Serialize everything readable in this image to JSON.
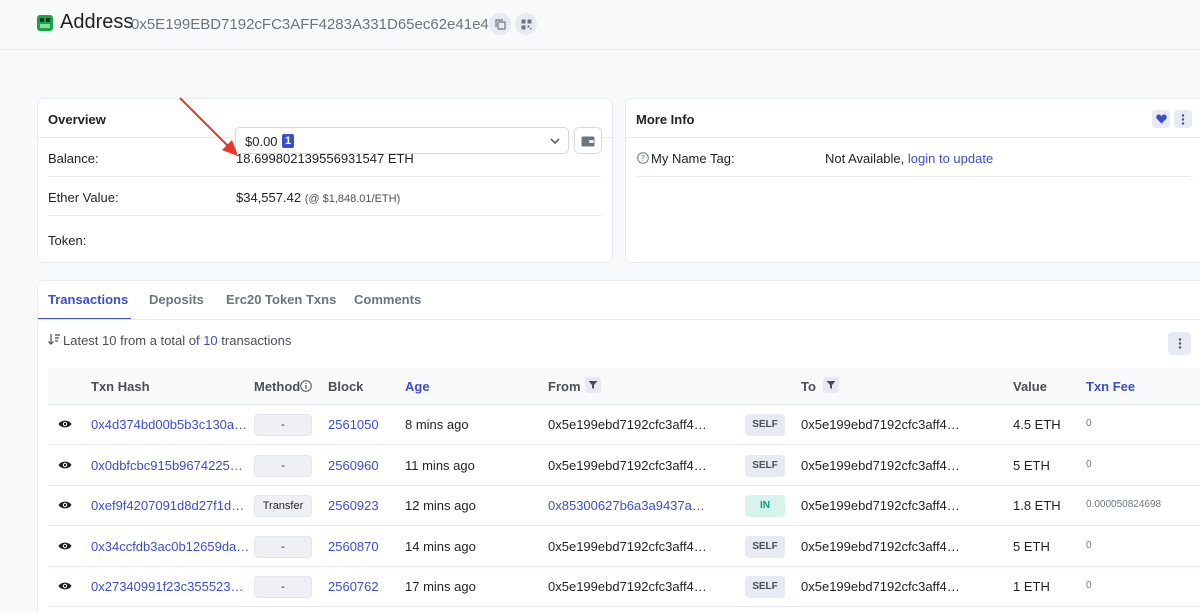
{
  "header": {
    "title": "Address",
    "address": "0x5E199EBD7192cFC3AFF4283A331D65ec62e41e46",
    "icons": [
      "logo-icon",
      "copy-icon",
      "qr-code-icon"
    ]
  },
  "overview": {
    "title": "Overview",
    "balance_label": "Balance:",
    "balance_value": "18.699802139556931547 ETH",
    "ether_value_label": "Ether Value:",
    "ether_value": "$34,557.42",
    "ether_price": "(@ $1,848.01/ETH)",
    "token_label": "Token:",
    "token_value": "$0.00",
    "token_count": "1"
  },
  "more_info": {
    "title": "More Info",
    "name_tag_label": "My Name Tag:",
    "name_tag_value": "Not Available,",
    "name_tag_link": "login to update"
  },
  "tabs": [
    {
      "label": "Transactions",
      "active": true
    },
    {
      "label": "Deposits",
      "active": false
    },
    {
      "label": "Erc20 Token Txns",
      "active": false
    },
    {
      "label": "Comments",
      "active": false
    }
  ],
  "summary": {
    "prefix": "Latest 10 from a total of",
    "count": "10",
    "suffix": "transactions"
  },
  "columns": {
    "txn_hash": "Txn Hash",
    "method": "Method",
    "block": "Block",
    "age": "Age",
    "from": "From",
    "to": "To",
    "value": "Value",
    "txn_fee": "Txn Fee"
  },
  "rows": [
    {
      "hash": "0x4d374bd00b5b3c130a…",
      "method": "-",
      "block": "2561050",
      "age": "8 mins ago",
      "from": "0x5e199ebd7192cfc3aff4…",
      "from_link": false,
      "dir": "SELF",
      "to": "0x5e199ebd7192cfc3aff4…",
      "value": "4.5 ETH",
      "fee": "0"
    },
    {
      "hash": "0x0dbfcbc915b9674225…",
      "method": "-",
      "block": "2560960",
      "age": "11 mins ago",
      "from": "0x5e199ebd7192cfc3aff4…",
      "from_link": false,
      "dir": "SELF",
      "to": "0x5e199ebd7192cfc3aff4…",
      "value": "5 ETH",
      "fee": "0"
    },
    {
      "hash": "0xef9f4207091d8d27f1d…",
      "method": "Transfer",
      "block": "2560923",
      "age": "12 mins ago",
      "from": "0x85300627b6a3a9437a…",
      "from_link": true,
      "dir": "IN",
      "to": "0x5e199ebd7192cfc3aff4…",
      "value": "1.8 ETH",
      "fee": "0.000050824698"
    },
    {
      "hash": "0x34ccfdb3ac0b12659da…",
      "method": "-",
      "block": "2560870",
      "age": "14 mins ago",
      "from": "0x5e199ebd7192cfc3aff4…",
      "from_link": false,
      "dir": "SELF",
      "to": "0x5e199ebd7192cfc3aff4…",
      "value": "5 ETH",
      "fee": "0"
    },
    {
      "hash": "0x27340991f23c355523…",
      "method": "-",
      "block": "2560762",
      "age": "17 mins ago",
      "from": "0x5e199ebd7192cfc3aff4…",
      "from_link": false,
      "dir": "SELF",
      "to": "0x5e199ebd7192cfc3aff4…",
      "value": "1 ETH",
      "fee": "0"
    }
  ],
  "colors": {
    "accent": "#3b4ec9",
    "annotation_arrow": "#e8362c",
    "in_badge": "#00a186",
    "border": "#e7eaf3"
  }
}
